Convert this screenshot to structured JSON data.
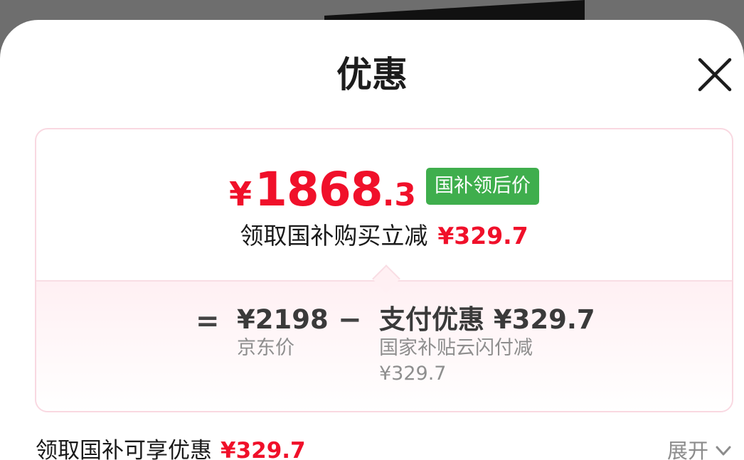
{
  "sheet": {
    "title": "优惠",
    "close_icon": "close-icon"
  },
  "summary": {
    "price_symbol": "¥",
    "price_integer": "1868",
    "price_decimal": ".3",
    "price_tag": "国补领后价",
    "subsidy_text": "领取国补购买立减",
    "subsidy_amount": "¥329.7"
  },
  "calculation": {
    "equals_sign": "=",
    "minus_sign": "−",
    "base_value": "¥2198",
    "base_label": "京东价",
    "discount_value": "支付优惠 ¥329.7",
    "discount_label": "国家补贴云闪付减",
    "discount_amount": "¥329.7"
  },
  "footer": {
    "label": "领取国补可享优惠",
    "amount": "¥329.7",
    "expand_label": "展开",
    "expand_icon": "chevron-down-icon"
  },
  "colors": {
    "accent_red": "#f0102a",
    "tag_green": "#3fae4d",
    "card_border": "#f9d8e1"
  }
}
